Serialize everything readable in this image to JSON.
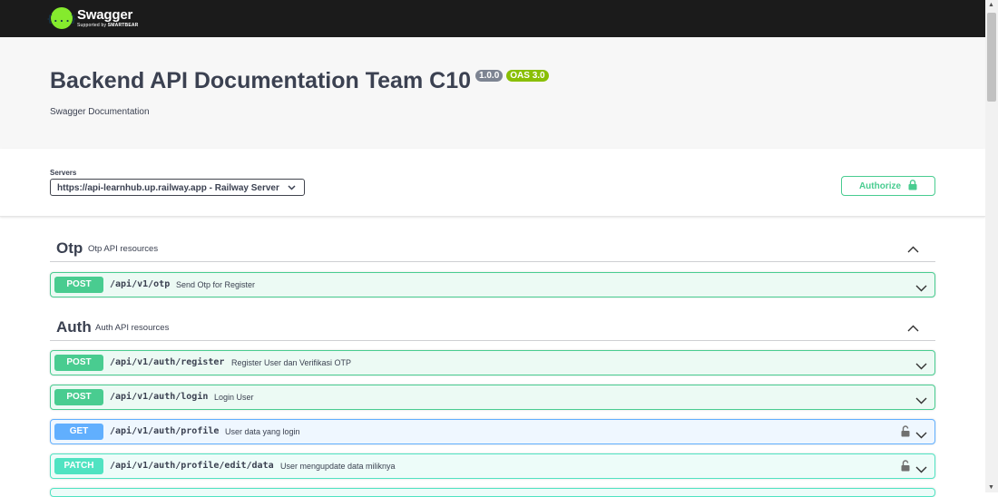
{
  "topbar": {
    "logo_glyph": "{...}",
    "logo_name": "Swagger",
    "logo_sub_prefix": "Supported by",
    "logo_sub_brand": "SMARTBEAR"
  },
  "info": {
    "title": "Backend API Documentation Team C10",
    "version": "1.0.0",
    "oas": "OAS 3.0",
    "description": "Swagger Documentation"
  },
  "servers": {
    "label": "Servers",
    "selected": "https://api-learnhub.up.railway.app - Railway Server"
  },
  "authorize": {
    "label": "Authorize"
  },
  "tags": [
    {
      "name": "Otp",
      "description": "Otp API resources"
    },
    {
      "name": "Auth",
      "description": "Auth API resources"
    }
  ],
  "operations": [
    {
      "method": "POST",
      "path": "/api/v1/otp",
      "summary": "Send Otp for Register",
      "locked": false
    },
    {
      "method": "POST",
      "path": "/api/v1/auth/register",
      "summary": "Register User dan Verifikasi OTP",
      "locked": false
    },
    {
      "method": "POST",
      "path": "/api/v1/auth/login",
      "summary": "Login User",
      "locked": false
    },
    {
      "method": "GET",
      "path": "/api/v1/auth/profile",
      "summary": "User data yang login",
      "locked": true
    },
    {
      "method": "PATCH",
      "path": "/api/v1/auth/profile/edit/data",
      "summary": "User mengupdate data miliknya",
      "locked": true
    }
  ],
  "colors": {
    "post": "#49cc90",
    "get": "#61affe",
    "patch": "#50e3c2",
    "topbar": "#1b1b1b",
    "logo": "#85ea2d"
  }
}
